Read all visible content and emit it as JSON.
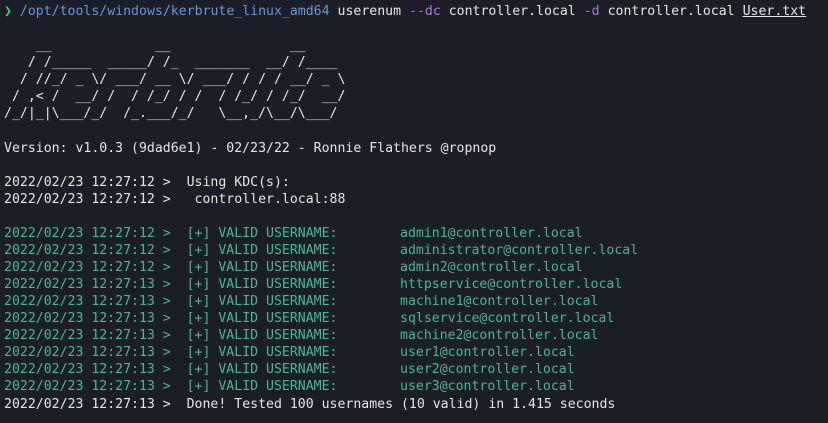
{
  "command": {
    "prompt_symbol": "❯",
    "path": "/opt/tools/windows/kerbrute_linux_amd64",
    "subcommand": "userenum",
    "flag_dc": "--dc",
    "dc_value": "controller.local",
    "flag_d": "-d",
    "domain_value": "controller.local",
    "userlist": "User.txt"
  },
  "banner": [
    "    __             __               __     ",
    "   / /_____  _____/ /_  _______  __/ /____ ",
    "  / //_/ _ \\/ ___/ __ \\/ ___/ / / / __/ _ \\",
    " / ,< /  __/ /  / /_/ / /  / /_/ / /_/  __/",
    "/_/|_|\\___/_/  /_.___/_/   \\__,_/\\__/\\___/ "
  ],
  "version_line": "Version: v1.0.3 (9dad6e1) - 02/23/22 - Ronnie Flathers @ropnop",
  "kdc": {
    "line1_ts": "2022/02/23 12:27:12 >",
    "line1_text": "  Using KDC(s):",
    "line2_ts": "2022/02/23 12:27:12 >",
    "line2_text": "   controller.local:88"
  },
  "results": [
    {
      "ts": "2022/02/23 12:27:12 >",
      "label": "  [+] VALID USERNAME:",
      "user": "admin1@controller.local"
    },
    {
      "ts": "2022/02/23 12:27:12 >",
      "label": "  [+] VALID USERNAME:",
      "user": "administrator@controller.local"
    },
    {
      "ts": "2022/02/23 12:27:12 >",
      "label": "  [+] VALID USERNAME:",
      "user": "admin2@controller.local"
    },
    {
      "ts": "2022/02/23 12:27:13 >",
      "label": "  [+] VALID USERNAME:",
      "user": "httpservice@controller.local"
    },
    {
      "ts": "2022/02/23 12:27:13 >",
      "label": "  [+] VALID USERNAME:",
      "user": "machine1@controller.local"
    },
    {
      "ts": "2022/02/23 12:27:13 >",
      "label": "  [+] VALID USERNAME:",
      "user": "sqlservice@controller.local"
    },
    {
      "ts": "2022/02/23 12:27:13 >",
      "label": "  [+] VALID USERNAME:",
      "user": "machine2@controller.local"
    },
    {
      "ts": "2022/02/23 12:27:13 >",
      "label": "  [+] VALID USERNAME:",
      "user": "user1@controller.local"
    },
    {
      "ts": "2022/02/23 12:27:13 >",
      "label": "  [+] VALID USERNAME:",
      "user": "user2@controller.local"
    },
    {
      "ts": "2022/02/23 12:27:13 >",
      "label": "  [+] VALID USERNAME:",
      "user": "user3@controller.local"
    }
  ],
  "done": {
    "ts": "2022/02/23 12:27:13 >",
    "text": "  Done! Tested 100 usernames (10 valid) in 1.415 seconds"
  },
  "colors": {
    "background": "#1b1e26",
    "prompt": "#3ad26b",
    "path": "#6a97d9",
    "flag": "#b575d6",
    "success": "#46b899",
    "text": "#e6e6e6"
  }
}
